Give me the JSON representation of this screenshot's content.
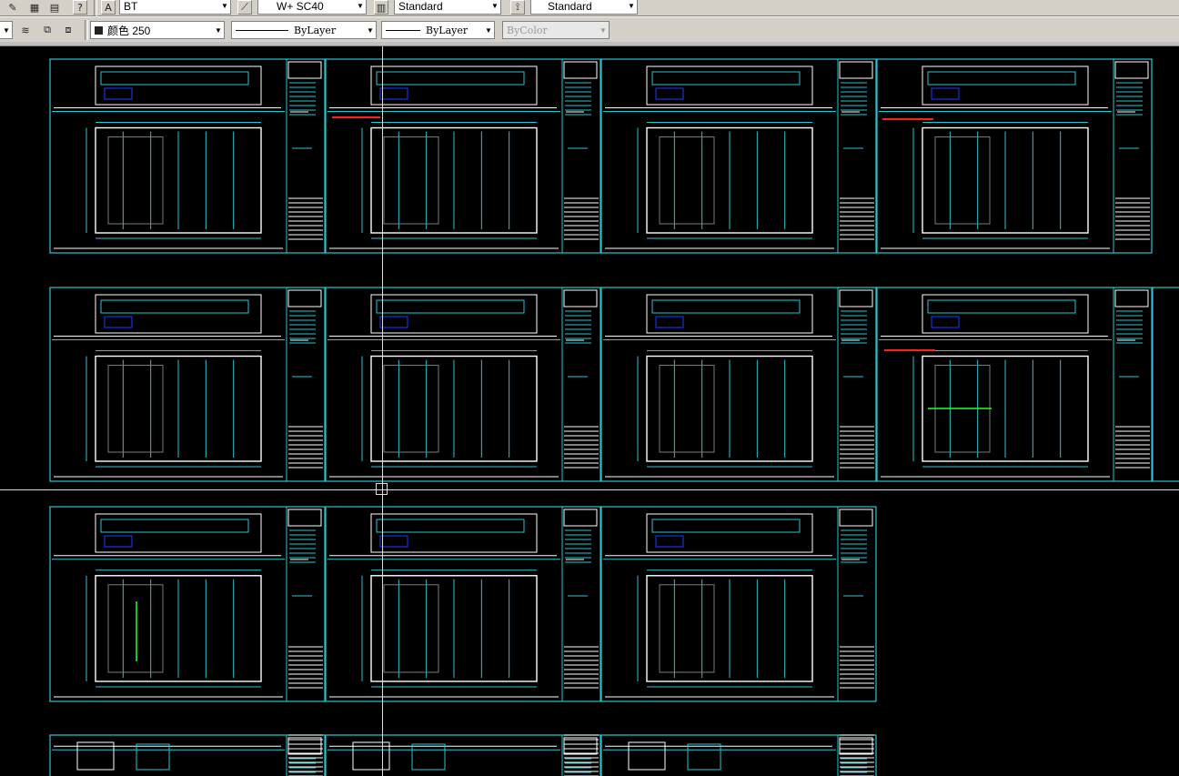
{
  "toolbar1": {
    "text_style": "BT",
    "dim_style": "W+ SC40",
    "table_style": "Standard",
    "multileader_style": "Standard",
    "help_glyph": "?"
  },
  "toolbar2": {
    "color_label": "颜色 250",
    "linetype": "ByLayer",
    "lineweight": "ByLayer",
    "plotstyle": "ByColor"
  },
  "icons": [
    "layer-properties-icon",
    "layer-state-icon",
    "layer-previous-icon",
    "text-style-icon",
    "dim-style-icon",
    "table-style-icon",
    "mleader-style-icon",
    "help-icon"
  ],
  "colors": {
    "sheet_border": "#2ec3d0",
    "geometry": "#ffffff",
    "accent_blue": "#1e3cff",
    "accent_red": "#ff2020",
    "accent_green": "#29ff29",
    "background": "#000000"
  }
}
